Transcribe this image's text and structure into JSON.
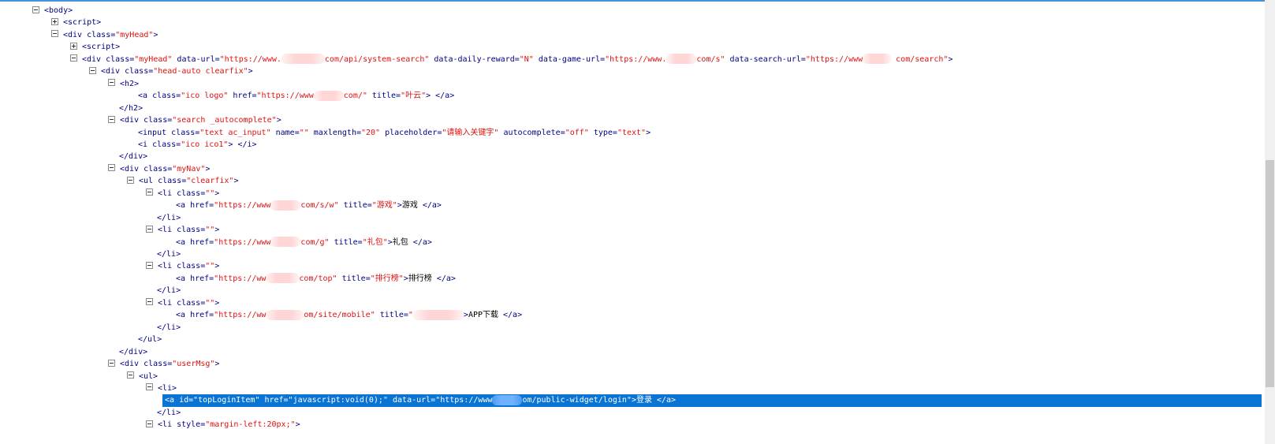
{
  "lines": [
    {
      "ind": 1,
      "tog": "minus",
      "segs": [
        [
          "tag",
          "<body>"
        ]
      ]
    },
    {
      "ind": 2,
      "tog": "plus",
      "segs": [
        [
          "tag",
          "<script>"
        ]
      ]
    },
    {
      "ind": 2,
      "tog": "minus",
      "segs": [
        [
          "tag",
          "<div  "
        ],
        [
          "attr",
          "class="
        ],
        [
          "val",
          "\"myHead\""
        ],
        [
          "tag",
          ">"
        ]
      ]
    },
    {
      "ind": 3,
      "tog": "plus",
      "segs": [
        [
          "tag",
          "<script>"
        ]
      ]
    },
    {
      "ind": 3,
      "tog": "minus",
      "segs": [
        [
          "tag",
          "<div  "
        ],
        [
          "attr",
          "class="
        ],
        [
          "val",
          "\"myHead\""
        ],
        [
          "attr",
          "  data-url="
        ],
        [
          "val",
          "\"https://www."
        ],
        [
          "redact",
          55
        ],
        [
          "val",
          "com/api/system-search\""
        ],
        [
          "attr",
          "  data-daily-reward="
        ],
        [
          "val",
          "\"N\""
        ],
        [
          "attr",
          "  data-game-url="
        ],
        [
          "val",
          "\"https://www."
        ],
        [
          "redact",
          38
        ],
        [
          "val",
          "com/s\""
        ],
        [
          "attr",
          "  data-search-url="
        ],
        [
          "val",
          "\"https://www"
        ],
        [
          "redact",
          36
        ],
        [
          "val",
          " com/search\""
        ],
        [
          "tag",
          ">"
        ]
      ]
    },
    {
      "ind": 4,
      "tog": "minus",
      "segs": [
        [
          "tag",
          "<div  "
        ],
        [
          "attr",
          "class="
        ],
        [
          "val",
          "\"head-auto clearfix\""
        ],
        [
          "tag",
          ">"
        ]
      ]
    },
    {
      "ind": 5,
      "tog": "minus",
      "segs": [
        [
          "tag",
          "<h2>"
        ]
      ]
    },
    {
      "ind": 6,
      "tog": "",
      "segs": [
        [
          "tag",
          "<a  "
        ],
        [
          "attr",
          "class="
        ],
        [
          "val",
          "\"ico logo\""
        ],
        [
          "attr",
          "  href="
        ],
        [
          "val",
          "\"https://www"
        ],
        [
          "redact",
          38
        ],
        [
          "val",
          "com/\""
        ],
        [
          "attr",
          "  title="
        ],
        [
          "val",
          "\"叶云\""
        ],
        [
          "tag",
          "> </a>"
        ]
      ]
    },
    {
      "ind": 5,
      "tog": "",
      "segs": [
        [
          "tag",
          "</h2>"
        ]
      ]
    },
    {
      "ind": 5,
      "tog": "minus",
      "segs": [
        [
          "tag",
          "<div  "
        ],
        [
          "attr",
          "class="
        ],
        [
          "val",
          "\"search _autocomplete\""
        ],
        [
          "tag",
          ">"
        ]
      ]
    },
    {
      "ind": 6,
      "tog": "",
      "segs": [
        [
          "tag",
          "<input  "
        ],
        [
          "attr",
          "class="
        ],
        [
          "val",
          "\"text ac_input\""
        ],
        [
          "attr",
          "  name="
        ],
        [
          "val",
          "\"\""
        ],
        [
          "attr",
          "  maxlength="
        ],
        [
          "val",
          "\"20\""
        ],
        [
          "attr",
          "  placeholder="
        ],
        [
          "val",
          "\"请输入关键字\""
        ],
        [
          "attr",
          "  autocomplete="
        ],
        [
          "val",
          "\"off\""
        ],
        [
          "attr",
          "  type="
        ],
        [
          "val",
          "\"text\""
        ],
        [
          "tag",
          ">"
        ]
      ]
    },
    {
      "ind": 6,
      "tog": "",
      "segs": [
        [
          "tag",
          "<i  "
        ],
        [
          "attr",
          "class="
        ],
        [
          "val",
          "\"ico ico1\""
        ],
        [
          "tag",
          "> </i>"
        ]
      ]
    },
    {
      "ind": 5,
      "tog": "",
      "segs": [
        [
          "tag",
          "</div>"
        ]
      ]
    },
    {
      "ind": 5,
      "tog": "minus",
      "segs": [
        [
          "tag",
          "<div  "
        ],
        [
          "attr",
          "class="
        ],
        [
          "val",
          "\"myNav\""
        ],
        [
          "tag",
          ">"
        ]
      ]
    },
    {
      "ind": 6,
      "tog": "minus",
      "segs": [
        [
          "tag",
          "<ul  "
        ],
        [
          "attr",
          "class="
        ],
        [
          "val",
          "\"clearfix\""
        ],
        [
          "tag",
          ">"
        ]
      ]
    },
    {
      "ind": 7,
      "tog": "minus",
      "segs": [
        [
          "tag",
          "<li  "
        ],
        [
          "attr",
          "class="
        ],
        [
          "val",
          "\"\""
        ],
        [
          "tag",
          ">"
        ]
      ]
    },
    {
      "ind": 8,
      "tog": "",
      "segs": [
        [
          "tag",
          "<a  "
        ],
        [
          "attr",
          "href="
        ],
        [
          "val",
          "\"https://www"
        ],
        [
          "redact",
          38
        ],
        [
          "val",
          "com/s/w\""
        ],
        [
          "attr",
          "  title="
        ],
        [
          "val",
          "\"游戏\""
        ],
        [
          "tag",
          ">"
        ],
        [
          "txt",
          "游戏"
        ],
        [
          "tag",
          " </a>"
        ]
      ]
    },
    {
      "ind": 7,
      "tog": "",
      "segs": [
        [
          "tag",
          "</li>"
        ]
      ]
    },
    {
      "ind": 7,
      "tog": "minus",
      "segs": [
        [
          "tag",
          "<li  "
        ],
        [
          "attr",
          "class="
        ],
        [
          "val",
          "\"\""
        ],
        [
          "tag",
          ">"
        ]
      ]
    },
    {
      "ind": 8,
      "tog": "",
      "segs": [
        [
          "tag",
          "<a  "
        ],
        [
          "attr",
          "href="
        ],
        [
          "val",
          "\"https://www"
        ],
        [
          "redact",
          38
        ],
        [
          "val",
          "com/g\""
        ],
        [
          "attr",
          "  title="
        ],
        [
          "val",
          "\"礼包\""
        ],
        [
          "tag",
          ">"
        ],
        [
          "txt",
          "礼包"
        ],
        [
          "tag",
          " </a>"
        ]
      ]
    },
    {
      "ind": 7,
      "tog": "",
      "segs": [
        [
          "tag",
          "</li>"
        ]
      ]
    },
    {
      "ind": 7,
      "tog": "minus",
      "segs": [
        [
          "tag",
          "<li  "
        ],
        [
          "attr",
          "class="
        ],
        [
          "val",
          "\"\""
        ],
        [
          "tag",
          ">"
        ]
      ]
    },
    {
      "ind": 8,
      "tog": "",
      "segs": [
        [
          "tag",
          "<a  "
        ],
        [
          "attr",
          "href="
        ],
        [
          "val",
          "\"https://ww"
        ],
        [
          "redact",
          42
        ],
        [
          "val",
          "com/top\""
        ],
        [
          "attr",
          "  title="
        ],
        [
          "val",
          "\"排行榜\""
        ],
        [
          "tag",
          ">"
        ],
        [
          "txt",
          "排行榜"
        ],
        [
          "tag",
          " </a>"
        ]
      ]
    },
    {
      "ind": 7,
      "tog": "",
      "segs": [
        [
          "tag",
          "</li>"
        ]
      ]
    },
    {
      "ind": 7,
      "tog": "minus",
      "segs": [
        [
          "tag",
          "<li  "
        ],
        [
          "attr",
          "class="
        ],
        [
          "val",
          "\"\""
        ],
        [
          "tag",
          ">"
        ]
      ]
    },
    {
      "ind": 8,
      "tog": "",
      "segs": [
        [
          "tag",
          "<a  "
        ],
        [
          "attr",
          "href="
        ],
        [
          "val",
          "\"https://ww"
        ],
        [
          "redact",
          48
        ],
        [
          "val",
          "om/site/mobile\""
        ],
        [
          "attr",
          "  title="
        ],
        [
          "val",
          "\""
        ],
        [
          "redact",
          64
        ],
        [
          "tag",
          ">"
        ],
        [
          "txt",
          "APP下载"
        ],
        [
          "tag",
          " </a>"
        ]
      ]
    },
    {
      "ind": 7,
      "tog": "",
      "segs": [
        [
          "tag",
          "</li>"
        ]
      ]
    },
    {
      "ind": 6,
      "tog": "",
      "segs": [
        [
          "tag",
          "</ul>"
        ]
      ]
    },
    {
      "ind": 5,
      "tog": "",
      "segs": [
        [
          "tag",
          "</div>"
        ]
      ]
    },
    {
      "ind": 5,
      "tog": "minus",
      "segs": [
        [
          "tag",
          "<div  "
        ],
        [
          "attr",
          "class="
        ],
        [
          "val",
          "\"userMsg\""
        ],
        [
          "tag",
          ">"
        ]
      ]
    },
    {
      "ind": 6,
      "tog": "minus",
      "segs": [
        [
          "tag",
          "<ul>"
        ]
      ]
    },
    {
      "ind": 7,
      "tog": "minus",
      "segs": [
        [
          "tag",
          "<li>"
        ]
      ]
    },
    {
      "ind": 8,
      "tog": "",
      "sel": true,
      "segs": [
        [
          "tag",
          "<a  "
        ],
        [
          "attr",
          "id="
        ],
        [
          "val",
          "\"topLoginItem\""
        ],
        [
          "attr",
          "  href="
        ],
        [
          "val",
          "\"javascript:void(0);\""
        ],
        [
          "attr",
          "  data-url="
        ],
        [
          "val",
          "\"https://www"
        ],
        [
          "redact",
          38
        ],
        [
          "val",
          "om/public-widget/login\""
        ],
        [
          "tag",
          ">"
        ],
        [
          "txt",
          "登录"
        ],
        [
          "tag",
          " </a>"
        ]
      ]
    },
    {
      "ind": 7,
      "tog": "",
      "segs": [
        [
          "tag",
          "</li>"
        ]
      ]
    },
    {
      "ind": 7,
      "tog": "minus",
      "segs": [
        [
          "tag",
          "<li  "
        ],
        [
          "attr",
          "style="
        ],
        [
          "val",
          "\"margin-left:20px;\""
        ],
        [
          "tag",
          ">"
        ]
      ]
    }
  ]
}
